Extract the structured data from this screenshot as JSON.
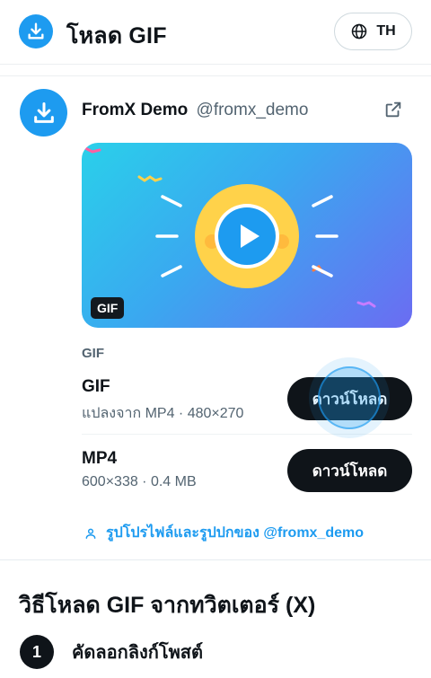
{
  "header": {
    "title": "โหลด GIF",
    "language_label": "TH"
  },
  "post": {
    "author_name": "FromX Demo",
    "author_handle": "@fromx_demo",
    "media_badge": "GIF",
    "section_label": "GIF",
    "options": [
      {
        "format": "GIF",
        "meta": "แปลงจาก MP4 · 480×270",
        "button": "ดาวน์โหลด"
      },
      {
        "format": "MP4",
        "meta": "600×338 · 0.4 MB",
        "button": "ดาวน์โหลด"
      }
    ],
    "profile_link": "รูปโปรไฟล์และรูปปกของ @fromx_demo"
  },
  "howto": {
    "title": "วิธีโหลด GIF จากทวิตเตอร์ (X)",
    "steps": [
      {
        "number": "1",
        "text": "คัดลอกลิงก์โพสต์"
      }
    ]
  },
  "colors": {
    "accent": "#1d9bf0",
    "button_dark": "#0f1419",
    "play_ring": "#ffd24a"
  },
  "icons": {
    "logo": "download-icon",
    "language": "globe-icon",
    "external": "external-link-icon",
    "play": "play-icon",
    "profile": "user-icon"
  }
}
